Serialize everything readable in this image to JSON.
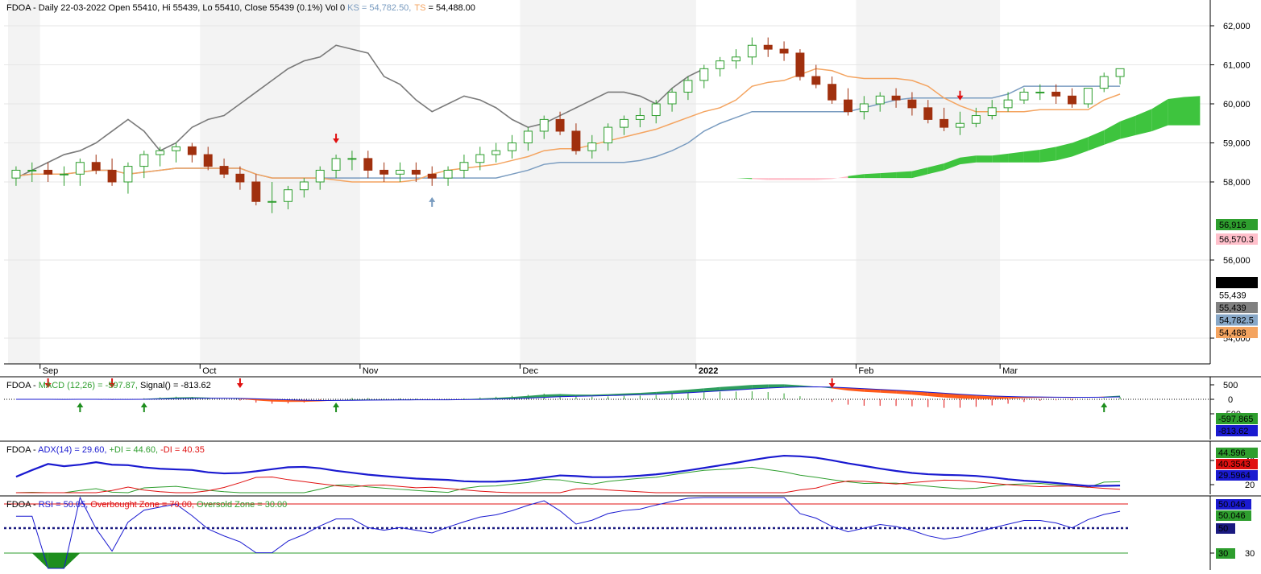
{
  "panels": {
    "price": {
      "header": {
        "prefix": "FDOA - Daily 22-03-2022 Open 55410, Hi 55439, Lo 55410, Close 55439 (0.1%) Vol 0 ",
        "ks": "KS = 54,782.50,",
        "ts_name": "TS",
        "ts_val": " = 54,488.00"
      },
      "y_ticks": [
        "62,000",
        "61,000",
        "60,000",
        "59,000",
        "58,000",
        "56,000",
        "54,000"
      ],
      "y_tick_values": [
        62000,
        61000,
        60000,
        59000,
        58000,
        56000,
        54000
      ],
      "x_labels": [
        "Sep",
        "Oct",
        "Nov",
        "Dec",
        "2022",
        "Feb",
        "Mar"
      ],
      "x_label_index": [
        2,
        12,
        22,
        32,
        43,
        53,
        62
      ],
      "tags": [
        {
          "text": "56,916",
          "bg": "#2e9e2e",
          "fg": "#ffffff",
          "value": 56916
        },
        {
          "text": "56,570.3",
          "bg": "#ffc0cb",
          "fg": "#000000",
          "value": 56570
        },
        {
          "text": "55,439",
          "bg": "#000000",
          "fg": "#ffffff",
          "value": 55439
        },
        {
          "text": "55,439",
          "bg": "#ffffff",
          "fg": "#000000",
          "value": 55100
        },
        {
          "text": "55,439",
          "bg": "#808080",
          "fg": "#000000",
          "value": 54800
        },
        {
          "text": "54,782.5",
          "bg": "#87a7c7",
          "fg": "#000000",
          "value": 54500
        },
        {
          "text": "54,488",
          "bg": "#f4a460",
          "fg": "#000000",
          "value": 54200
        }
      ]
    },
    "macd": {
      "header": {
        "prefix": "FDOA - ",
        "macd": "MACD (12,26) = -597.87,",
        "signal": " Signal() = -813.62"
      },
      "y_ticks": [
        "500",
        "0",
        "-500"
      ],
      "tags": [
        {
          "text": "-597.865",
          "bg": "#2e9e2e",
          "fg": "#ffffff"
        },
        {
          "text": "-813.62",
          "bg": "#1a1ad0",
          "fg": "#ffffff"
        }
      ]
    },
    "adx": {
      "header": {
        "prefix": "FDOA - ",
        "adx": "ADX(14) = 29.60,",
        "pdi": " +DI = 44.60,",
        "mdi": " -DI = 40.35"
      },
      "y_ticks": [
        "40",
        "20"
      ],
      "tags": [
        {
          "text": "44.596",
          "bg": "#2e9e2e",
          "fg": "#ffffff"
        },
        {
          "text": "40.3543",
          "bg": "#e01010",
          "fg": "#ffffff"
        },
        {
          "text": "29.5964",
          "bg": "#1a1ad0",
          "fg": "#ffffff"
        }
      ]
    },
    "rsi": {
      "header": {
        "prefix": "FDOA - ",
        "rsi": "RSI = 50.05,",
        "ob": " Overbought Zone = 70.00,",
        "os": " Oversold Zone = 30.00"
      },
      "y_ticks": [
        "30"
      ],
      "tags": [
        {
          "text": "50.046",
          "bg": "#1a1ad0",
          "fg": "#ffffff"
        },
        {
          "text": "50.046",
          "bg": "#2e9e2e",
          "fg": "#ffffff"
        },
        {
          "text": "50",
          "bg": "#1a1a80",
          "fg": "#ffffff"
        },
        {
          "text": "30",
          "bg": "#2e9e2e",
          "fg": "#ffffff"
        }
      ]
    }
  },
  "colors": {
    "up_candle": "#2e9e2e",
    "down_candle": "#a0300e",
    "kijun": "#7a9cc0",
    "tenkan": "#f4a460",
    "chikou": "#7a7a7a",
    "cloud_bull": "#3ec43e",
    "cloud_bear": "#ffc0cb",
    "macd_area_up": "#2e9e5e",
    "macd_area_down": "#ff5a1a",
    "adx": "#1a1ad0",
    "pdi": "#2e9e2e",
    "mdi": "#e01010",
    "rsi": "#1a1ad0"
  },
  "chart_data": [
    {
      "type": "candlestick",
      "indicator": "Ichimoku",
      "x_count": 70,
      "open": [
        58100,
        58300,
        58300,
        58200,
        58200,
        58500,
        58300,
        58000,
        58400,
        58700,
        58800,
        58900,
        58700,
        58400,
        58200,
        58000,
        57500,
        57500,
        57800,
        58000,
        58300,
        58600,
        58600,
        58300,
        58200,
        58300,
        58200,
        58100,
        58300,
        58500,
        58700,
        58800,
        59000,
        59300,
        59600,
        59300,
        58800,
        59000,
        59400,
        59600,
        59700,
        60000,
        60300,
        60600,
        60900,
        61100,
        61200,
        61500,
        61400,
        61300,
        60700,
        60500,
        60100,
        59800,
        60000,
        60200,
        60100,
        59900,
        59600,
        59400,
        59500,
        59700,
        59900,
        60100,
        60300,
        60300,
        60200,
        60000,
        60400,
        60700
      ],
      "high": [
        58400,
        58500,
        58500,
        58400,
        58600,
        58700,
        58600,
        58500,
        58800,
        58900,
        59000,
        59000,
        58900,
        58600,
        58400,
        58200,
        58000,
        57900,
        58100,
        58400,
        58700,
        58800,
        58800,
        58500,
        58500,
        58500,
        58400,
        58400,
        58700,
        58900,
        59000,
        59200,
        59400,
        59700,
        59800,
        59500,
        59200,
        59500,
        59700,
        59900,
        60100,
        60400,
        60700,
        61000,
        61200,
        61400,
        61700,
        61700,
        61600,
        61400,
        61000,
        60700,
        60400,
        60200,
        60300,
        60400,
        60300,
        60100,
        59900,
        59800,
        59900,
        60100,
        60300,
        60400,
        60500,
        60500,
        60400,
        60400,
        60800,
        60900
      ],
      "low": [
        57900,
        58000,
        58000,
        57900,
        57900,
        58200,
        57900,
        57700,
        58100,
        58400,
        58500,
        58500,
        58300,
        58100,
        57800,
        57400,
        57200,
        57300,
        57600,
        57800,
        58100,
        58300,
        58100,
        58000,
        58000,
        58000,
        57900,
        57900,
        58100,
        58300,
        58500,
        58600,
        58800,
        59100,
        59200,
        58700,
        58600,
        58800,
        59200,
        59400,
        59500,
        59800,
        60100,
        60400,
        60700,
        60900,
        61000,
        61200,
        61100,
        60600,
        60400,
        60000,
        59700,
        59600,
        59800,
        59900,
        59700,
        59500,
        59300,
        59200,
        59400,
        59600,
        59800,
        60000,
        60100,
        60000,
        59900,
        59900,
        60300,
        60500
      ],
      "close": [
        58300,
        58300,
        58200,
        58200,
        58500,
        58300,
        58000,
        58400,
        58700,
        58800,
        58900,
        58700,
        58400,
        58200,
        58000,
        57500,
        57500,
        57800,
        58000,
        58300,
        58600,
        58600,
        58300,
        58200,
        58300,
        58200,
        58100,
        58300,
        58500,
        58700,
        58800,
        59000,
        59300,
        59600,
        59300,
        58800,
        59000,
        59400,
        59600,
        59700,
        60000,
        60300,
        60600,
        60900,
        61100,
        61200,
        61500,
        61400,
        61300,
        60700,
        60500,
        60100,
        59800,
        60000,
        60200,
        60100,
        59900,
        59600,
        59400,
        59500,
        59700,
        59900,
        60100,
        60300,
        60300,
        60200,
        60000,
        60400,
        60700,
        60900
      ]
    }
  ]
}
